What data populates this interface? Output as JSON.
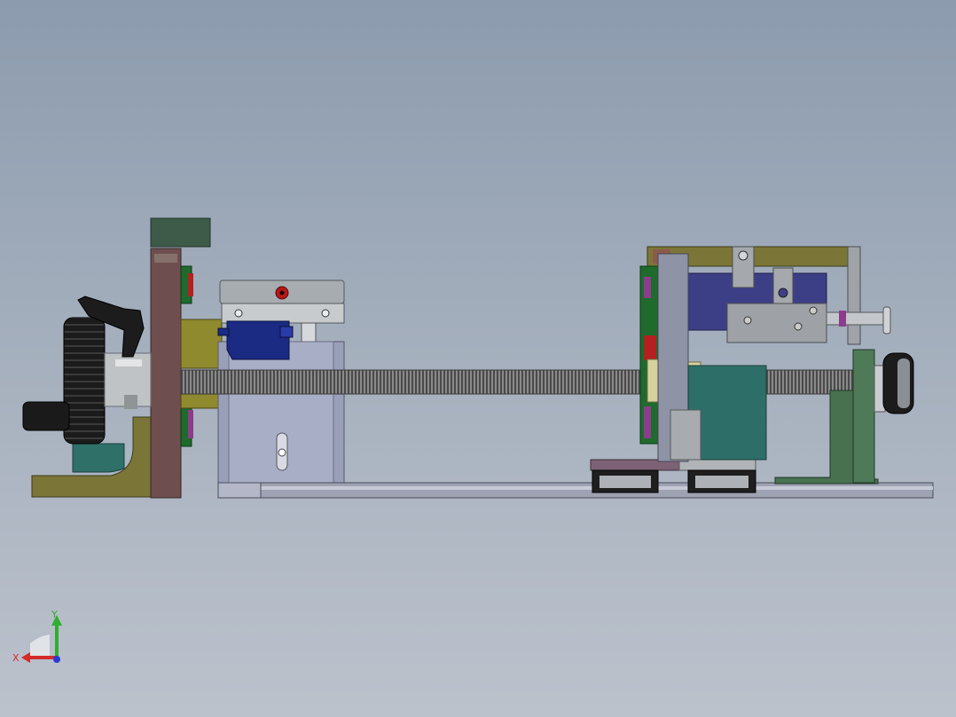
{
  "viewport": {
    "background_top": "#8c9bae",
    "background_bottom": "#bcc2cc"
  },
  "triad": {
    "x_label": "X",
    "y_label": "Y",
    "x_color": "#d42a2a",
    "y_color": "#2fae2f",
    "z_color": "#2a3ad4"
  },
  "model": {
    "parts": [
      "handwheel",
      "clamp-lever",
      "left-bracket",
      "left-end-plate",
      "limit-switch-block",
      "switch-bracket",
      "lead-screw",
      "linear-rail",
      "carriage-plate",
      "right-mechanism",
      "right-support",
      "pulley"
    ]
  }
}
